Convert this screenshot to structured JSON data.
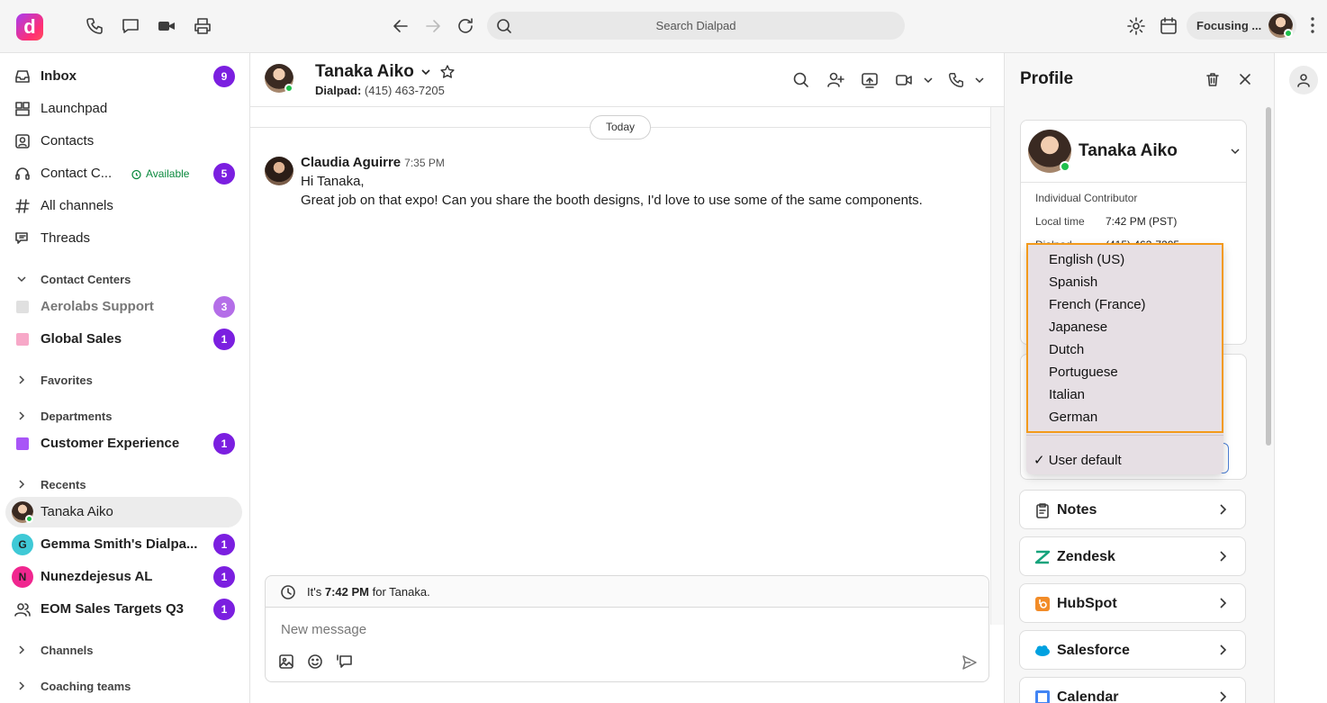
{
  "app": {
    "logo_letter": "d",
    "search_placeholder": "Search Dialpad",
    "focus_label": "Focusing ..."
  },
  "sidebar": {
    "items": [
      {
        "label": "Inbox",
        "badge": "9"
      },
      {
        "label": "Launchpad"
      },
      {
        "label": "Contacts"
      },
      {
        "label": "Contact C...",
        "status": "Available",
        "badge": "5"
      },
      {
        "label": "All channels"
      },
      {
        "label": "Threads"
      }
    ],
    "contact_centers": {
      "title": "Contact Centers",
      "items": [
        {
          "label": "Aerolabs Support",
          "badge": "3",
          "color": "#e0e0e0"
        },
        {
          "label": "Global Sales",
          "badge": "1",
          "color": "#f7a8c8"
        }
      ]
    },
    "favorites": {
      "title": "Favorites"
    },
    "departments": {
      "title": "Departments",
      "items": [
        {
          "label": "Customer Experience",
          "badge": "1",
          "color": "#a855f7"
        }
      ]
    },
    "recents": {
      "title": "Recents",
      "items": [
        {
          "label": "Tanaka Aiko"
        },
        {
          "label": "Gemma Smith's Dialpa...",
          "initial": "G",
          "badge": "1",
          "color": "#3fc9d6"
        },
        {
          "label": "Nunezdejesus AL",
          "initial": "N",
          "badge": "1",
          "color": "#f0268f"
        },
        {
          "label": "EOM Sales Targets Q3",
          "badge": "1"
        }
      ]
    },
    "channels": {
      "title": "Channels"
    },
    "coaching": {
      "title": "Coaching teams"
    }
  },
  "chat": {
    "contact_name": "Tanaka Aiko",
    "subtitle_label": "Dialpad:",
    "subtitle_number": "(415) 463-7205",
    "date_divider": "Today",
    "message": {
      "author": "Claudia Aguirre",
      "time": "7:35 PM",
      "line1": "Hi Tanaka,",
      "line2": "Great job on that expo! Can you share the booth designs, I'd love to use some of the same components."
    },
    "local_time_prefix": "It's",
    "local_time": "7:42 PM",
    "local_time_suffix": "for Tanaka.",
    "composer_placeholder": "New message"
  },
  "profile": {
    "title": "Profile",
    "name": "Tanaka Aiko",
    "role": "Individual Contributor",
    "local_time_label": "Local time",
    "local_time_value": "7:42 PM (PST)",
    "dialpad_label": "Dialpad",
    "dialpad_value": "(415) 463-7205",
    "integrations": [
      {
        "label": "Notes"
      },
      {
        "label": "Zendesk",
        "color": "#03363d"
      },
      {
        "label": "HubSpot",
        "color": "#ff7a59"
      },
      {
        "label": "Salesforce",
        "color": "#00a1e0"
      },
      {
        "label": "Calendar"
      }
    ]
  },
  "language_dropdown": {
    "options": [
      "English (US)",
      "Spanish",
      "French (France)",
      "Japanese",
      "Dutch",
      "Portuguese",
      "Italian",
      "German"
    ],
    "selected": "✓ User default"
  }
}
